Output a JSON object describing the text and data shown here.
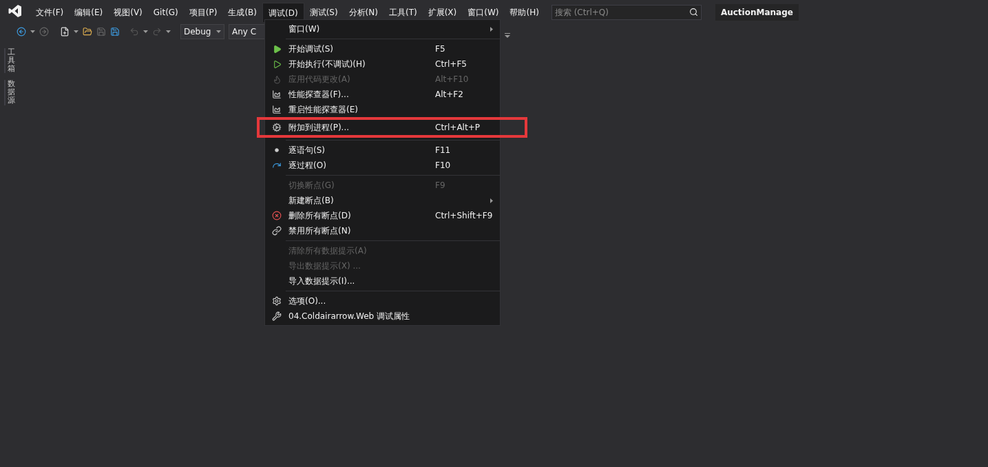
{
  "menubar": {
    "items": [
      {
        "label": "文件(F)",
        "selected": false
      },
      {
        "label": "编辑(E)",
        "selected": false
      },
      {
        "label": "视图(V)",
        "selected": false
      },
      {
        "label": "Git(G)",
        "selected": false
      },
      {
        "label": "项目(P)",
        "selected": false
      },
      {
        "label": "生成(B)",
        "selected": false
      },
      {
        "label": "调试(D)",
        "selected": true
      },
      {
        "label": "测试(S)",
        "selected": false
      },
      {
        "label": "分析(N)",
        "selected": false
      },
      {
        "label": "工具(T)",
        "selected": false
      },
      {
        "label": "扩展(X)",
        "selected": false
      },
      {
        "label": "窗口(W)",
        "selected": false
      },
      {
        "label": "帮助(H)",
        "selected": false
      }
    ],
    "search": {
      "placeholder": "搜索 (Ctrl+Q)"
    },
    "solution_title": "AuctionManage"
  },
  "toolbar": {
    "configuration": "Debug",
    "platform": "Any C"
  },
  "side_tabs": [
    "工具箱",
    "数据源"
  ],
  "debug_menu": {
    "items": [
      {
        "kind": "item",
        "label": "窗口(W)",
        "submenu": true,
        "disabled": false
      },
      {
        "kind": "separator"
      },
      {
        "kind": "item",
        "label": "开始调试(S)",
        "shortcut": "F5",
        "disabled": false
      },
      {
        "kind": "item",
        "label": "开始执行(不调试)(H)",
        "shortcut": "Ctrl+F5",
        "disabled": false
      },
      {
        "kind": "item",
        "label": "应用代码更改(A)",
        "shortcut": "Alt+F10",
        "disabled": true
      },
      {
        "kind": "item",
        "label": "性能探查器(F)...",
        "shortcut": "Alt+F2",
        "disabled": false
      },
      {
        "kind": "item",
        "label": "重启性能探查器(E)",
        "disabled": false
      },
      {
        "kind": "item",
        "label": "附加到进程(P)...",
        "shortcut": "Ctrl+Alt+P",
        "disabled": false,
        "annotated": true
      },
      {
        "kind": "separator"
      },
      {
        "kind": "item",
        "label": "逐语句(S)",
        "shortcut": "F11",
        "disabled": false
      },
      {
        "kind": "item",
        "label": "逐过程(O)",
        "shortcut": "F10",
        "disabled": false
      },
      {
        "kind": "separator"
      },
      {
        "kind": "item",
        "label": "切换断点(G)",
        "shortcut": "F9",
        "disabled": true
      },
      {
        "kind": "item",
        "label": "新建断点(B)",
        "submenu": true,
        "disabled": false
      },
      {
        "kind": "item",
        "label": "删除所有断点(D)",
        "shortcut": "Ctrl+Shift+F9",
        "disabled": false
      },
      {
        "kind": "item",
        "label": "禁用所有断点(N)",
        "disabled": false
      },
      {
        "kind": "separator"
      },
      {
        "kind": "item",
        "label": "清除所有数据提示(A)",
        "disabled": true
      },
      {
        "kind": "item",
        "label": "导出数据提示(X) ...",
        "disabled": true
      },
      {
        "kind": "item",
        "label": "导入数据提示(I)...",
        "disabled": false
      },
      {
        "kind": "separator"
      },
      {
        "kind": "item",
        "label": "选项(O)...",
        "disabled": false
      },
      {
        "kind": "item",
        "label": "04.Coldairarrow.Web 调试属性",
        "disabled": false
      }
    ]
  }
}
